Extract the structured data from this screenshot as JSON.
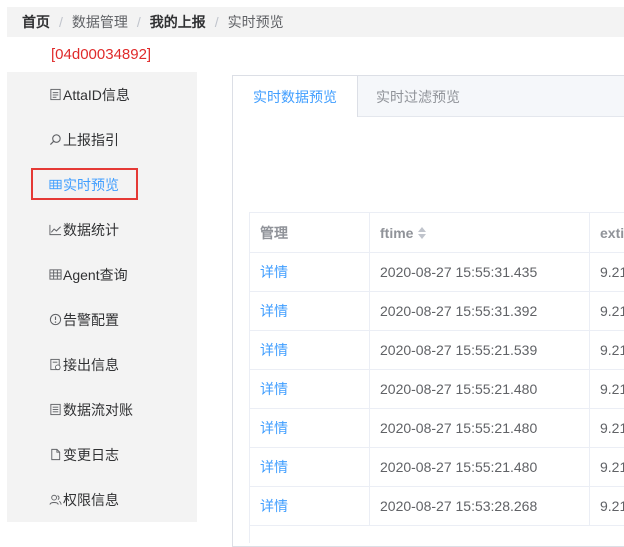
{
  "breadcrumb": {
    "items": [
      "首页",
      "数据管理",
      "我的上报",
      "实时预览"
    ],
    "separator": "/"
  },
  "app_id": "[04d00034892]",
  "sidebar": {
    "items": [
      {
        "label": "AttaID信息",
        "icon": "document-icon"
      },
      {
        "label": "上报指引",
        "icon": "search-icon"
      },
      {
        "label": "实时预览",
        "icon": "table-icon"
      },
      {
        "label": "数据统计",
        "icon": "line-chart-icon"
      },
      {
        "label": "Agent查询",
        "icon": "grid-icon"
      },
      {
        "label": "告警配置",
        "icon": "clock-icon"
      },
      {
        "label": "接出信息",
        "icon": "export-icon"
      },
      {
        "label": "数据流对账",
        "icon": "ledger-icon"
      },
      {
        "label": "变更日志",
        "icon": "file-icon"
      },
      {
        "label": "权限信息",
        "icon": "users-icon"
      }
    ],
    "active_index": 2
  },
  "tabs": [
    {
      "label": "实时数据预览",
      "active": true
    },
    {
      "label": "实时过滤预览",
      "active": false
    }
  ],
  "table": {
    "columns": [
      "管理",
      "ftime",
      "exti"
    ],
    "rows": [
      {
        "action": "详情",
        "ftime": "2020-08-27 15:55:31.435",
        "extra": "9.21"
      },
      {
        "action": "详情",
        "ftime": "2020-08-27 15:55:31.392",
        "extra": "9.21"
      },
      {
        "action": "详情",
        "ftime": "2020-08-27 15:55:21.539",
        "extra": "9.21"
      },
      {
        "action": "详情",
        "ftime": "2020-08-27 15:55:21.480",
        "extra": "9.21"
      },
      {
        "action": "详情",
        "ftime": "2020-08-27 15:55:21.480",
        "extra": "9.21"
      },
      {
        "action": "详情",
        "ftime": "2020-08-27 15:55:21.480",
        "extra": "9.21"
      },
      {
        "action": "详情",
        "ftime": "2020-08-27 15:53:28.268",
        "extra": "9.21"
      }
    ]
  },
  "colors": {
    "accent": "#409eff",
    "highlight_border": "#e53935",
    "app_id": "#e02a2a"
  }
}
